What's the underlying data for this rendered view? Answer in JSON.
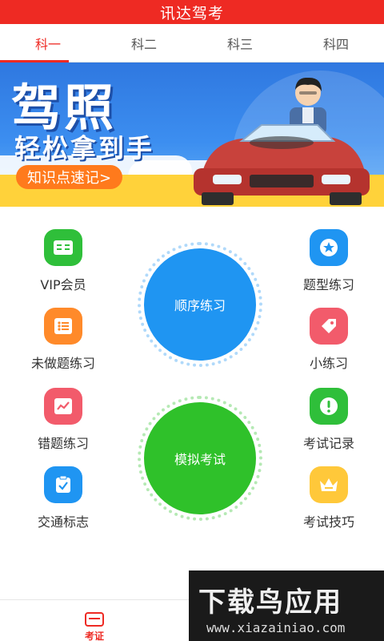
{
  "header": {
    "title": "讯达驾考"
  },
  "tabs": [
    {
      "label": "科一",
      "active": true
    },
    {
      "label": "科二",
      "active": false
    },
    {
      "label": "科三",
      "active": false
    },
    {
      "label": "科四",
      "active": false
    }
  ],
  "banner": {
    "title": "驾照",
    "subtitle": "轻松拿到手",
    "pill": "知识点速记>"
  },
  "menu": {
    "left": [
      {
        "label": "VIP会员",
        "icon": "card-icon",
        "color": "#2fbf3a"
      },
      {
        "label": "未做题练习",
        "icon": "list-icon",
        "color": "#ff8a2a"
      },
      {
        "label": "错题练习",
        "icon": "chart-icon",
        "color": "#f25b6b"
      },
      {
        "label": "交通标志",
        "icon": "clipboard-check-icon",
        "color": "#1f95f2"
      }
    ],
    "right": [
      {
        "label": "题型练习",
        "icon": "star-icon",
        "color": "#1f95f2"
      },
      {
        "label": "小练习",
        "icon": "tag-icon",
        "color": "#f25b6b"
      },
      {
        "label": "考试记录",
        "icon": "alert-icon",
        "color": "#2fbf3a"
      },
      {
        "label": "考试技巧",
        "icon": "crown-icon",
        "color": "#ffc83a"
      }
    ]
  },
  "circles": {
    "sequence": "顺序练习",
    "mock": "模拟考试"
  },
  "bottom": {
    "exam_label": "考证"
  },
  "watermark": {
    "brand": "下载鸟应用",
    "url": "www.xiazainiao.com"
  }
}
